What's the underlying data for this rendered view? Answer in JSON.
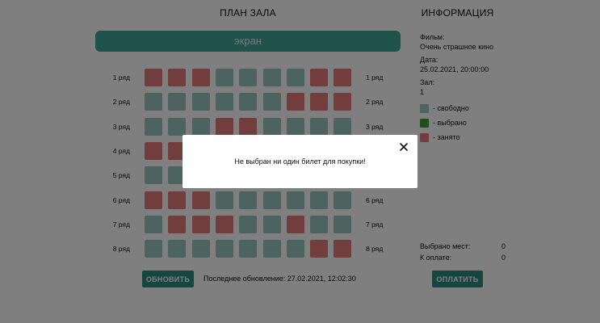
{
  "hall": {
    "title": "ПЛАН ЗАЛА",
    "screen_label": "экран",
    "rows": [
      {
        "label": "1 ряд",
        "seats": [
          "taken",
          "taken",
          "taken",
          "free",
          "free",
          "free",
          "free",
          "taken",
          "taken"
        ]
      },
      {
        "label": "2 ряд",
        "seats": [
          "free",
          "free",
          "free",
          "free",
          "free",
          "free",
          "taken",
          "taken",
          "taken"
        ]
      },
      {
        "label": "3 ряд",
        "seats": [
          "free",
          "free",
          "free",
          "taken",
          "taken",
          "free",
          "free",
          "free",
          "free"
        ]
      },
      {
        "label": "4 ряд",
        "seats": [
          "taken",
          "taken",
          "free",
          "free",
          "free",
          "free",
          "free",
          "free",
          "free"
        ]
      },
      {
        "label": "5 ряд",
        "seats": [
          "free",
          "free",
          "free",
          "free",
          "free",
          "free",
          "free",
          "free",
          "free"
        ]
      },
      {
        "label": "6 ряд",
        "seats": [
          "taken",
          "taken",
          "taken",
          "free",
          "free",
          "free",
          "free",
          "free",
          "free"
        ]
      },
      {
        "label": "7 ряд",
        "seats": [
          "free",
          "taken",
          "taken",
          "taken",
          "free",
          "free",
          "taken",
          "free",
          "free"
        ]
      },
      {
        "label": "8 ряд",
        "seats": [
          "free",
          "free",
          "free",
          "free",
          "free",
          "free",
          "free",
          "taken",
          "taken"
        ]
      }
    ],
    "update_button": "ОБНОВИТЬ",
    "last_update": "Последнее обновление: 27.02.2021, 12:02:30"
  },
  "info": {
    "title": "ИНФОРМАЦИЯ",
    "film_label": "Фильм:",
    "film_value": "Очень страшное кино",
    "date_label": "Дата:",
    "date_value": "25.02.2021, 20:00:00",
    "hall_label": "Зал:",
    "hall_value": "1",
    "legend": {
      "free": "- свободно",
      "selected": "- выбрано",
      "taken": "- занято"
    },
    "selected_count_label": "Выбрано мест:",
    "selected_count_value": "0",
    "to_pay_label": "К оплате:",
    "to_pay_value": "0",
    "pay_button": "ОПЛАТИТЬ"
  },
  "colors": {
    "free": "#98c7c0",
    "selected": "#3c9f3c",
    "taken": "#e57b7b",
    "accent": "#3ea696"
  },
  "modal": {
    "message": "Не выбран ни один билет для покупки!",
    "close_icon": "close-icon"
  }
}
